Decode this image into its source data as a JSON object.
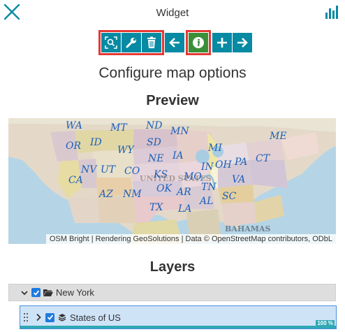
{
  "header": {
    "title": "Widget",
    "close_icon": "close-icon",
    "chart_icon": "bar-chart-icon"
  },
  "toolbar": {
    "buttons": [
      {
        "icon": "zoom-to-extent-icon"
      },
      {
        "icon": "wrench-icon"
      },
      {
        "icon": "trash-icon"
      },
      {
        "icon": "arrow-left-icon"
      },
      {
        "icon": "info-icon"
      },
      {
        "icon": "plus-icon"
      },
      {
        "icon": "arrow-right-icon"
      }
    ],
    "highlight_color": "#e53935",
    "button_color": "#078aa3",
    "active_color": "#3b8f37"
  },
  "main": {
    "heading": "Configure map options",
    "preview_heading": "Preview",
    "layers_heading": "Layers"
  },
  "map": {
    "attribution": "OSM Bright | Rendering GeoSolutions | Data © OpenStreetMap contributors, ODbL",
    "state_labels": [
      "WA",
      "MT",
      "ND",
      "MN",
      "ME",
      "OR",
      "ID",
      "SD",
      "WY",
      "MI",
      "NE",
      "IA",
      "CT",
      "NV",
      "UT",
      "CO",
      "KS",
      "PA",
      "OH",
      "IN",
      "CA",
      "MO",
      "VA",
      "OK",
      "AZ",
      "NM",
      "AR",
      "TN",
      "SC",
      "TX",
      "LA",
      "AL"
    ],
    "background_labels": [
      "UNITED STATES",
      "BAHAMAS"
    ]
  },
  "layers": {
    "group": {
      "name": "New York",
      "expanded": true,
      "checked": true
    },
    "layer": {
      "name": "States of US",
      "checked": true,
      "progress_label": "100 %",
      "progress": 1.0
    }
  }
}
